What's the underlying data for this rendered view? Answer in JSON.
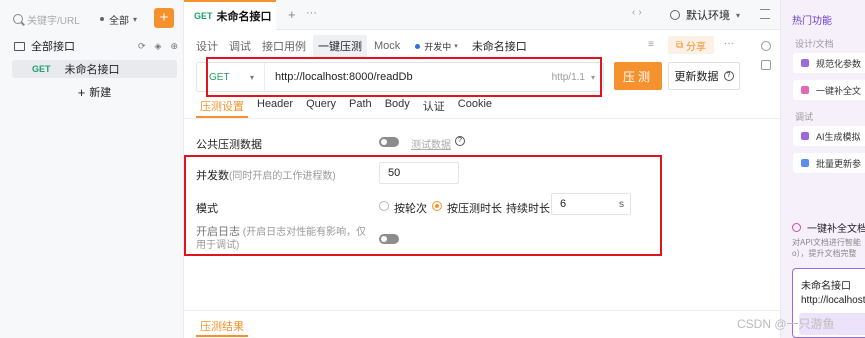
{
  "sidebar": {
    "search_placeholder": "关键字/URL",
    "filter": "全部",
    "add": "+",
    "all_apis": "全部接口",
    "item": {
      "method": "GET",
      "name": "未命名接口"
    },
    "new_label": "新建",
    "new_plus": "+"
  },
  "tabbar": {
    "tab": {
      "method": "GET",
      "name": "未命名接口"
    },
    "add": "+",
    "more": "···",
    "nav": "‹›",
    "env": "默认环境"
  },
  "subbar": {
    "tabs": [
      "设计",
      "调试",
      "接口用例",
      "一键压测",
      "Mock"
    ],
    "branch": "开发中",
    "name": "未命名接口",
    "share": "分享",
    "more": "···"
  },
  "request": {
    "method": "GET",
    "url": "http://localhost:8000/readDb",
    "protocol": "http/1.1",
    "send": "压测",
    "update": "更新数据"
  },
  "req_tabs": [
    "压测设置",
    "Header",
    "Query",
    "Path",
    "Body",
    "认证",
    "Cookie"
  ],
  "form": {
    "public_data": "公共压测数据",
    "test_data_link": "测试数据",
    "concurrency_label": "并发数",
    "concurrency_hint": "(同时开启的工作进程数)",
    "concurrency_value": "50",
    "mode_label": "模式",
    "mode_by_rounds": "按轮次",
    "mode_by_duration": "按压测时长",
    "duration_label": "持续时长:",
    "duration_value": "6",
    "duration_unit": "s",
    "log_label": "开启日志",
    "log_hint": "(开启日志对性能有影响，仅用于调试)"
  },
  "result_tab": "压测结果",
  "right_panel": {
    "hot": "热门功能",
    "group1": "设计/文档",
    "card1": "规范化参数",
    "card2": "一键补全文",
    "group2": "调试",
    "card3": "AI生成模拟",
    "card4": "批量更新参",
    "fill_title": "一键补全文档",
    "fill_desc1": "对API文档进行智能",
    "fill_desc2": "o），提升文档完整",
    "preview_title": "未命名接口",
    "preview_url": "http://localhost:"
  },
  "watermark": "CSDN @一只游鱼",
  "colors": {
    "accent": "#f6922e",
    "get": "#22a06b",
    "highlight": "#e0141f",
    "purple": "#6b3fc9"
  }
}
